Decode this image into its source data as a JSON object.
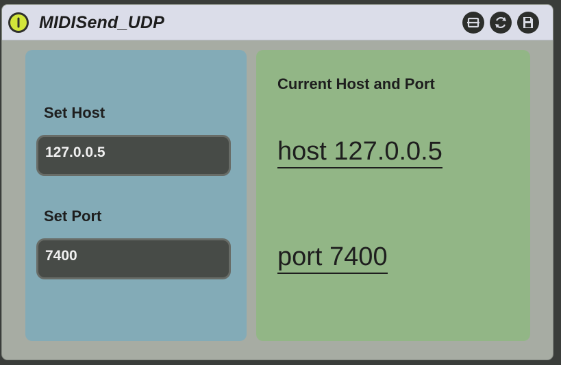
{
  "device": {
    "title": "MIDISend_UDP",
    "icons": {
      "power": "power-icon",
      "freeze": "freeze-icon",
      "hot_swap": "hot-swap-icon",
      "save": "save-icon"
    }
  },
  "left_panel": {
    "host_label": "Set Host",
    "host_value": "127.0.0.5",
    "port_label": "Set Port",
    "port_value": "7400"
  },
  "right_panel": {
    "title": "Current Host and Port",
    "host_message": "host 127.0.0.5",
    "port_message": "port 7400"
  },
  "colors": {
    "host_panel": "#83abb7",
    "status_panel": "#92b686",
    "power_on": "#d3e63a",
    "field_bg": "#474b47"
  }
}
